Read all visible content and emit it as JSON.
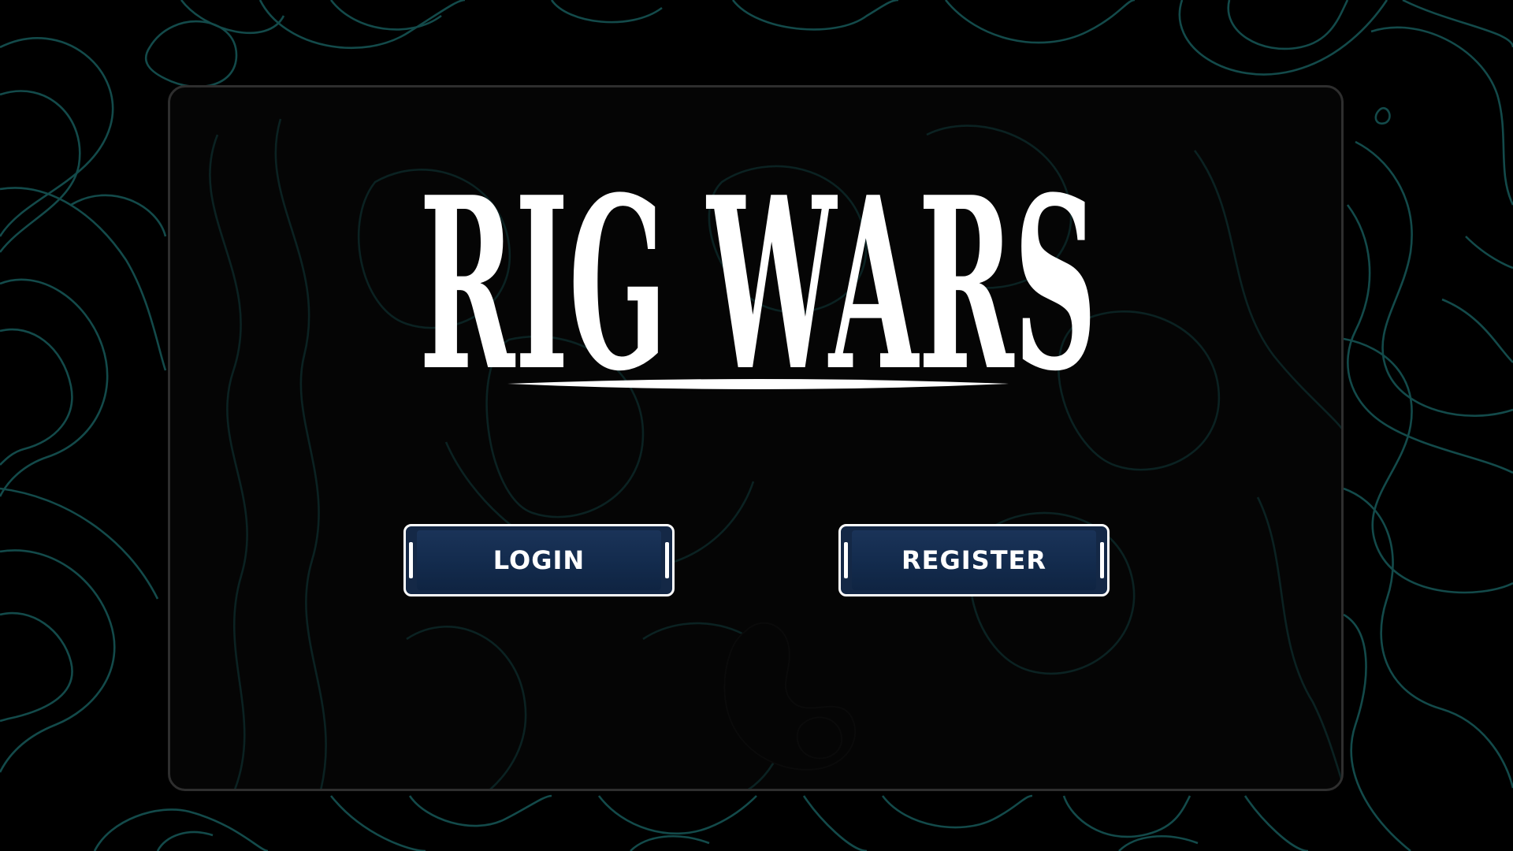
{
  "app": {
    "title": "RIG WARS"
  },
  "buttons": {
    "login_label": "LOGIN",
    "register_label": "REGISTER"
  },
  "colors": {
    "background": "#000000",
    "topo_lines": "#134a4a",
    "panel_border": "#2e2e2e",
    "button_fill": "#142846",
    "button_border": "#ffffff",
    "text": "#ffffff"
  },
  "icons": {
    "background_pattern": "topographic-contour-lines",
    "mascot": "mascot-silhouette"
  }
}
